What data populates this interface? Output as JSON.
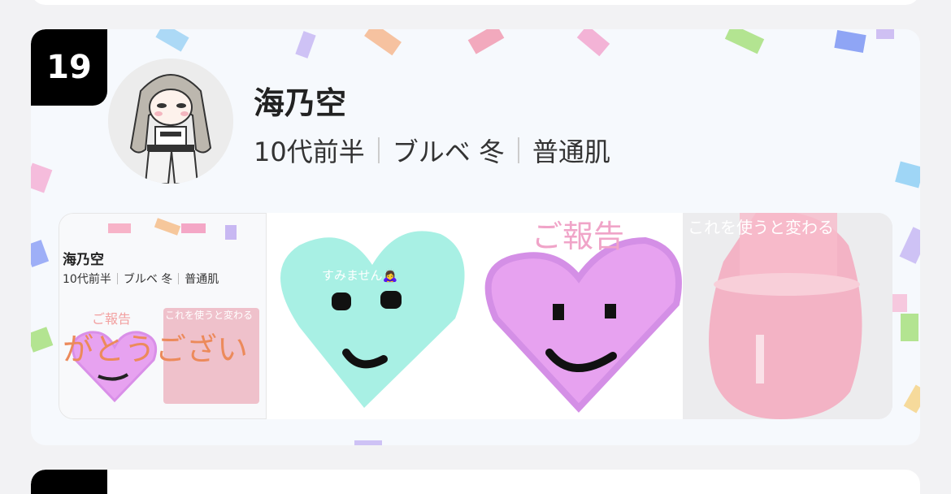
{
  "entry": {
    "rank": "19",
    "name": "海乃空",
    "meta": [
      "10代前半",
      "ブルベ 冬",
      "普通肌"
    ]
  },
  "thumbnails": [
    {
      "type": "profile-preview",
      "name": "海乃空",
      "meta": [
        "10代前半",
        "ブルベ 冬",
        "普通肌"
      ],
      "inner_texts": [
        "ご報告",
        "これを使うと変わる",
        "がとうござい"
      ]
    },
    {
      "type": "heart-drawing",
      "caption": "すみません🙇‍♀️",
      "heart_color": "#a8f0e4"
    },
    {
      "type": "heart-drawing",
      "caption": "ご報告",
      "heart_color": "#e7a2f0"
    },
    {
      "type": "product-photo",
      "caption": "これを使うと変わる",
      "product_color": "#f4a9bd"
    }
  ],
  "colors": {
    "card_bg": "#f6f9fd",
    "rank_bg": "#000000",
    "page_bg": "#f2f2f4"
  }
}
